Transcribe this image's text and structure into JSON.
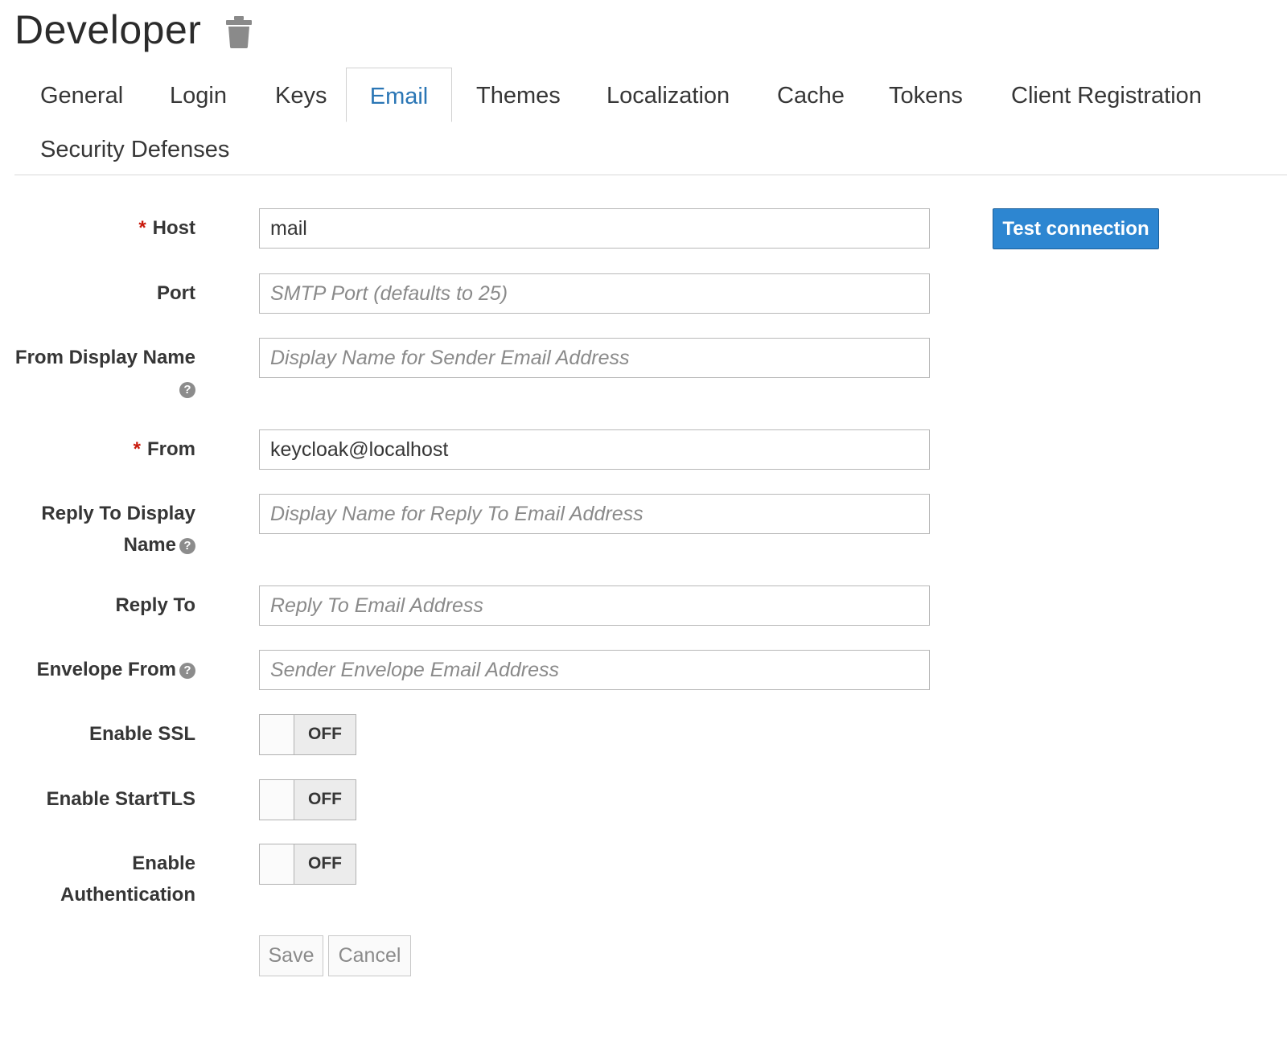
{
  "header": {
    "title": "Developer",
    "delete_icon": "trash-icon"
  },
  "tabs": [
    {
      "label": "General"
    },
    {
      "label": "Login"
    },
    {
      "label": "Keys"
    },
    {
      "label": "Email",
      "active": true
    },
    {
      "label": "Themes"
    },
    {
      "label": "Localization"
    },
    {
      "label": "Cache"
    },
    {
      "label": "Tokens"
    },
    {
      "label": "Client Registration"
    },
    {
      "label": "Security Defenses"
    }
  ],
  "form": {
    "host": {
      "label": "Host",
      "required_mark": "*",
      "value": "mail"
    },
    "port": {
      "label": "Port",
      "placeholder": "SMTP Port (defaults to 25)"
    },
    "from_display_name": {
      "label": "From Display Name",
      "placeholder": "Display Name for Sender Email Address"
    },
    "from": {
      "label": "From",
      "required_mark": "*",
      "value": "keycloak@localhost"
    },
    "reply_to_display_name": {
      "label_line1": "Reply To Display",
      "label_line2": "Name",
      "placeholder": "Display Name for Reply To Email Address"
    },
    "reply_to": {
      "label": "Reply To",
      "placeholder": "Reply To Email Address"
    },
    "envelope_from": {
      "label": "Envelope From",
      "placeholder": "Sender Envelope Email Address"
    },
    "enable_ssl": {
      "label": "Enable SSL",
      "state": "OFF"
    },
    "enable_starttls": {
      "label": "Enable StartTLS",
      "state": "OFF"
    },
    "enable_authentication": {
      "label_line1": "Enable",
      "label_line2": "Authentication",
      "state": "OFF"
    },
    "help_icon_glyph": "?"
  },
  "actions": {
    "test_connection": "Test connection",
    "save": "Save",
    "cancel": "Cancel"
  },
  "colors": {
    "accent": "#2d86d1",
    "active_tab": "#2a76b5",
    "required": "#c9190b"
  }
}
